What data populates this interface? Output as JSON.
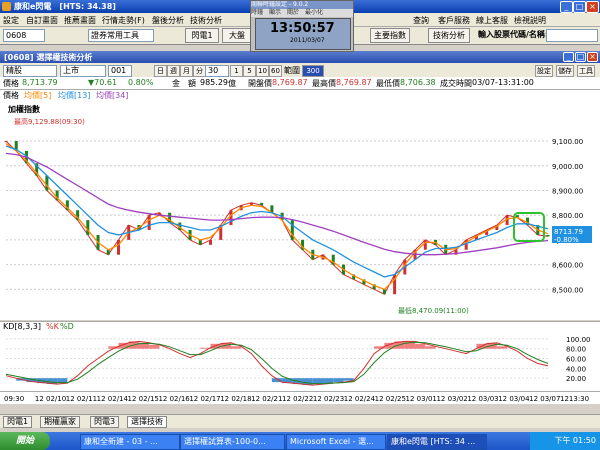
{
  "window": {
    "title": "康和e閃電　[HTS: 34.38]"
  },
  "menu": [
    "設定",
    "自訂畫面",
    "推薦畫面",
    "行情走勢(F)",
    "盤後分析",
    "技術分析",
    "",
    "",
    "",
    "",
    "",
    "",
    "",
    "查詢",
    "客戶服務",
    "線上客服",
    "檢視説明"
  ],
  "toolbar": {
    "stock_code": "0608",
    "tool_select": "證券常用工具",
    "btn1": "閃電1",
    "btn2": "大盤",
    "btn3": "主要指數",
    "btn4": "技術分析",
    "search_label": "輸入股票代碼/名稱:"
  },
  "clock": {
    "title": "關聯時鐘設定 - 9.0.2",
    "menu": "時鐘　顯示　關於　最小化",
    "time": "13:50:57",
    "date": "2011/03/07"
  },
  "inner": {
    "title": "[0608] 選擇權技術分析"
  },
  "ctrl": {
    "period": "精股",
    "market": "上市",
    "number": "001",
    "periods": [
      "日",
      "週",
      "月",
      "分"
    ],
    "minute": "30",
    "steps": [
      "1",
      "5",
      "10",
      "60"
    ],
    "range_label": "範圍",
    "range_value": "300",
    "right_btns": [
      "設定",
      "儲存",
      "工具"
    ]
  },
  "info": {
    "price_label": "價格",
    "price": "8,713.79",
    "change": "▼70.61",
    "pct": "0.80%",
    "amount_label": "金　額",
    "amount": "985.29",
    "amount_unit": "億",
    "open_label": "開盤價",
    "open": "8,769.87",
    "high_label": "最高價",
    "high": "8,769.87",
    "low_label": "最低價",
    "low": "8,706.38",
    "time_label": "成交時間",
    "time": "03/07-13:31:00"
  },
  "legend": {
    "price": "價格",
    "ma5": "均價[5]",
    "ma13": "均價[13]",
    "ma34": "均價[34]"
  },
  "index_name": "加權指數",
  "chart_data": {
    "type": "line",
    "ylim": [
      8400,
      9250
    ],
    "yticks": [
      "9,100.00",
      "9,000.00",
      "8,900.00",
      "8,800.00",
      "8,700.00",
      "8,600.00",
      "8,500.00"
    ],
    "ytick_values": [
      9100,
      9000,
      8900,
      8800,
      8700,
      8600,
      8500
    ],
    "annotations": {
      "high": "最高9,129.88(09:30)",
      "low": "最低8,470.09(11:00)",
      "last_price": "8713.79",
      "last_change": "-0.80%"
    },
    "x_labels": [
      "09:30",
      "12 02/10",
      "12 02/11",
      "12 02/14",
      "12 02/15",
      "12 02/16",
      "12 02/17",
      "12 02/18",
      "12 02/21",
      "12 02/22",
      "12 02/23",
      "12 02/24",
      "12 02/25",
      "12 03/01",
      "12 03/02",
      "12 03/03",
      "12 03/04",
      "12 03/07",
      "1213:30"
    ],
    "series": [
      {
        "name": "價格",
        "color": "#d03030",
        "values": [
          9100,
          9060,
          9010,
          8960,
          8900,
          8860,
          8820,
          8780,
          8720,
          8660,
          8640,
          8700,
          8760,
          8740,
          8800,
          8810,
          8770,
          8740,
          8700,
          8680,
          8700,
          8760,
          8820,
          8840,
          8850,
          8840,
          8810,
          8780,
          8700,
          8660,
          8620,
          8640,
          8600,
          8560,
          8540,
          8520,
          8500,
          8480,
          8560,
          8620,
          8660,
          8700,
          8680,
          8640,
          8660,
          8700,
          8720,
          8740,
          8760,
          8800,
          8790,
          8760,
          8720,
          8714
        ]
      },
      {
        "name": "均價[5]",
        "color": "#ff8800",
        "values": [
          9090,
          9060,
          9020,
          8970,
          8920,
          8870,
          8830,
          8790,
          8740,
          8690,
          8660,
          8680,
          8730,
          8750,
          8780,
          8800,
          8780,
          8750,
          8720,
          8700,
          8710,
          8750,
          8800,
          8830,
          8840,
          8835,
          8810,
          8780,
          8720,
          8670,
          8640,
          8630,
          8610,
          8580,
          8555,
          8535,
          8515,
          8500,
          8540,
          8600,
          8650,
          8690,
          8690,
          8660,
          8665,
          8690,
          8715,
          8735,
          8755,
          8785,
          8790,
          8770,
          8740,
          8725
        ]
      },
      {
        "name": "均價[13]",
        "color": "#2090e0",
        "values": [
          9080,
          9065,
          9040,
          9000,
          8960,
          8920,
          8880,
          8840,
          8800,
          8760,
          8730,
          8720,
          8730,
          8740,
          8760,
          8770,
          8770,
          8760,
          8750,
          8740,
          8740,
          8755,
          8775,
          8795,
          8810,
          8815,
          8810,
          8795,
          8760,
          8730,
          8700,
          8680,
          8660,
          8635,
          8610,
          8590,
          8570,
          8550,
          8560,
          8590,
          8620,
          8650,
          8665,
          8665,
          8670,
          8685,
          8700,
          8715,
          8730,
          8750,
          8765,
          8765,
          8755,
          8745
        ]
      },
      {
        "name": "均價[34]",
        "color": "#a040c0",
        "values": [
          9050,
          9045,
          9035,
          9015,
          8995,
          8970,
          8945,
          8920,
          8895,
          8870,
          8845,
          8830,
          8820,
          8812,
          8806,
          8800,
          8796,
          8792,
          8788,
          8784,
          8780,
          8780,
          8782,
          8786,
          8790,
          8792,
          8792,
          8790,
          8782,
          8772,
          8760,
          8748,
          8735,
          8720,
          8705,
          8690,
          8676,
          8662,
          8652,
          8646,
          8642,
          8640,
          8640,
          8642,
          8645,
          8650,
          8656,
          8662,
          8668,
          8676,
          8684,
          8690,
          8694,
          8697
        ]
      }
    ]
  },
  "kd": {
    "label": "KD[8,3,3]",
    "k_label": "%K",
    "d_label": "%D",
    "ylim": [
      0,
      110
    ],
    "yticks": [
      "100.00",
      "80.00",
      "60.00",
      "40.00",
      "20.00"
    ],
    "ytick_values": [
      100,
      80,
      60,
      40,
      20
    ],
    "k": [
      25,
      20,
      15,
      12,
      10,
      8,
      10,
      25,
      45,
      60,
      75,
      85,
      92,
      95,
      92,
      88,
      80,
      70,
      62,
      70,
      82,
      90,
      92,
      85,
      70,
      45,
      25,
      12,
      10,
      8,
      6,
      8,
      10,
      12,
      15,
      40,
      70,
      85,
      92,
      95,
      95,
      90,
      85,
      80,
      75,
      70,
      80,
      90,
      92,
      85,
      75,
      60,
      50,
      45
    ],
    "d": [
      28,
      24,
      20,
      16,
      13,
      11,
      11,
      18,
      32,
      48,
      62,
      75,
      85,
      90,
      91,
      89,
      84,
      76,
      68,
      68,
      76,
      85,
      89,
      87,
      78,
      60,
      40,
      24,
      16,
      12,
      9,
      9,
      10,
      11,
      13,
      28,
      52,
      72,
      85,
      91,
      93,
      92,
      88,
      84,
      79,
      74,
      76,
      84,
      89,
      87,
      80,
      68,
      58,
      50
    ]
  },
  "tabs": [
    "閃電1",
    "期權贏家",
    "閃電3",
    "選擇技術"
  ],
  "taskbar": {
    "start": "開始",
    "tasks": [
      "康和全新建 - 03 - ...",
      "選擇權試算表-100-0...",
      "Microsoft Excel - 選...",
      "康和e閃電 [HTS: 34 ..."
    ],
    "tray": "下午 01:50"
  },
  "colors": {
    "up": "#d03030",
    "down": "#208020",
    "accent": "#2a4eb0"
  }
}
